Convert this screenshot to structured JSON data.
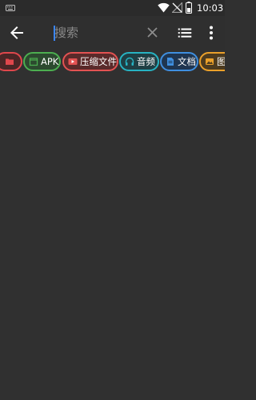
{
  "status_bar": {
    "time": "10:03",
    "icons": [
      "keyboard-icon",
      "wifi-icon",
      "no-signal-icon",
      "battery-icon"
    ]
  },
  "toolbar": {
    "back_icon": "arrow-left-icon",
    "search": {
      "placeholder": "搜索",
      "value": ""
    },
    "clear_icon": "close-icon",
    "list_icon": "list-view-icon",
    "more_icon": "more-vertical-icon"
  },
  "filters": [
    {
      "id": "folder",
      "label": "",
      "icon": "folder-icon",
      "color": "#e0474c"
    },
    {
      "id": "apk",
      "label": "APK",
      "icon": "android-package-icon",
      "color": "#4caf50"
    },
    {
      "id": "zip",
      "label": "压缩文件",
      "icon": "archive-icon",
      "color": "#e35252"
    },
    {
      "id": "audio",
      "label": "音频",
      "icon": "headphones-icon",
      "color": "#27b3c2"
    },
    {
      "id": "doc",
      "label": "文档",
      "icon": "document-icon",
      "color": "#3f8fe0"
    },
    {
      "id": "image",
      "label": "图",
      "icon": "image-icon",
      "color": "#eaa02a"
    }
  ],
  "colors": {
    "background": "#303030",
    "toolbar": "#2f2f2f",
    "caret": "#3b87ff"
  }
}
